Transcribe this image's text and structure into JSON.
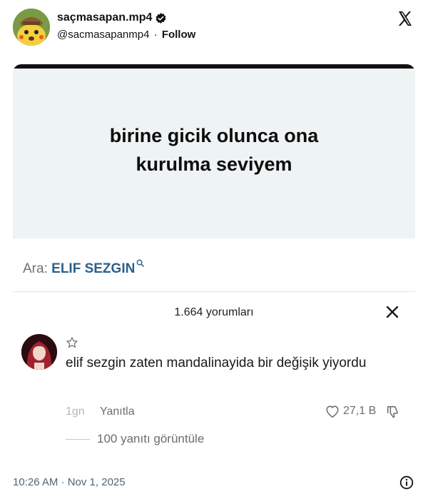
{
  "tweet": {
    "display_name": "saçmasapan.mp4",
    "handle": "@sacmasapanmp4",
    "separator": "·",
    "follow_label": "Follow",
    "timestamp": "10:26 AM · Nov 1, 2025"
  },
  "icons": {
    "verified": "verified-badge-icon",
    "x_logo": "x-logo-icon",
    "info": "info-icon"
  },
  "media": {
    "caption_line1": "birine gicik olunca ona",
    "caption_line2": "kurulma seviyem",
    "search_label": "Ara:",
    "search_query": "ELIF SEZGIN",
    "comments_count": "1.664 yorumları",
    "comment": {
      "text": "elif sezgin zaten mandalinayida bir değişik yiyordu",
      "age": "1gn",
      "reply_label": "Yanıtla",
      "likes": "27,1 B"
    },
    "view_replies": "100 yanıtı görüntüle"
  },
  "colors": {
    "search_query": "#2b5f8a",
    "verified": "#1d9bf0",
    "caption_bg": "#eef3f4"
  }
}
